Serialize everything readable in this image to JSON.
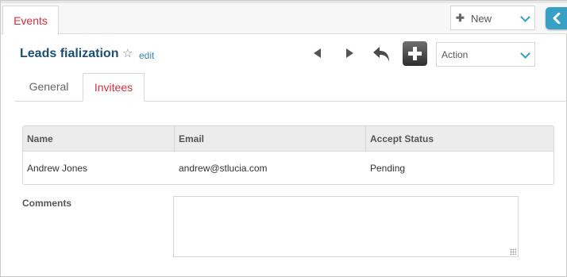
{
  "topbar": {
    "module_tab_label": "Events",
    "new_select": {
      "selected": "New",
      "icon": "plus-icon"
    }
  },
  "record": {
    "title": "Leads fialization",
    "favorite_icon": "star-outline-icon",
    "edit_label": "edit"
  },
  "toolbar": {
    "action_select": {
      "selected": "Action"
    },
    "icons": [
      "previous-record-icon",
      "next-record-icon",
      "undo-icon",
      "add-icon"
    ]
  },
  "tabs": [
    {
      "label": "General",
      "active": false
    },
    {
      "label": "Invitees",
      "active": true
    }
  ],
  "invitees": {
    "columns": [
      "Name",
      "Email",
      "Accept Status"
    ],
    "rows": [
      {
        "name": "Andrew Jones",
        "email": "andrew@stlucia.com",
        "status": "Pending"
      }
    ]
  },
  "comments": {
    "label": "Comments",
    "value": ""
  },
  "colors": {
    "accent_red": "#d42e3c",
    "title_blue": "#1b4f72",
    "link_blue": "#2e86b4",
    "toggle_blue": "#37a0c4"
  }
}
